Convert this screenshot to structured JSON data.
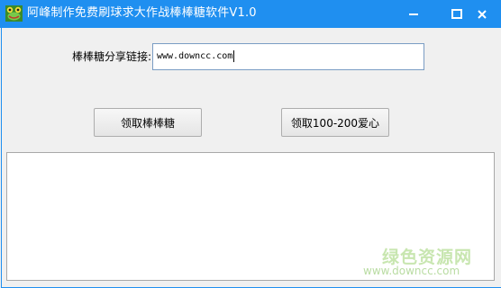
{
  "window": {
    "title": "阿峰制作免费刷球求大作战棒棒糖软件V1.0",
    "icon": "app-frog-icon",
    "controls": [
      "minimize-icon",
      "maximize-icon",
      "close-icon"
    ],
    "accent_color": "#1f8ff0"
  },
  "form": {
    "share_label": "棒棒糖分享链接",
    "share_value": "www.downcc.com"
  },
  "buttons": {
    "get_lollipop": "领取棒棒糖",
    "get_hearts": "领取100-200爱心"
  },
  "output": {
    "text": ""
  },
  "watermark": {
    "brand": "绿色资源网",
    "url": "www.downcc.com"
  }
}
